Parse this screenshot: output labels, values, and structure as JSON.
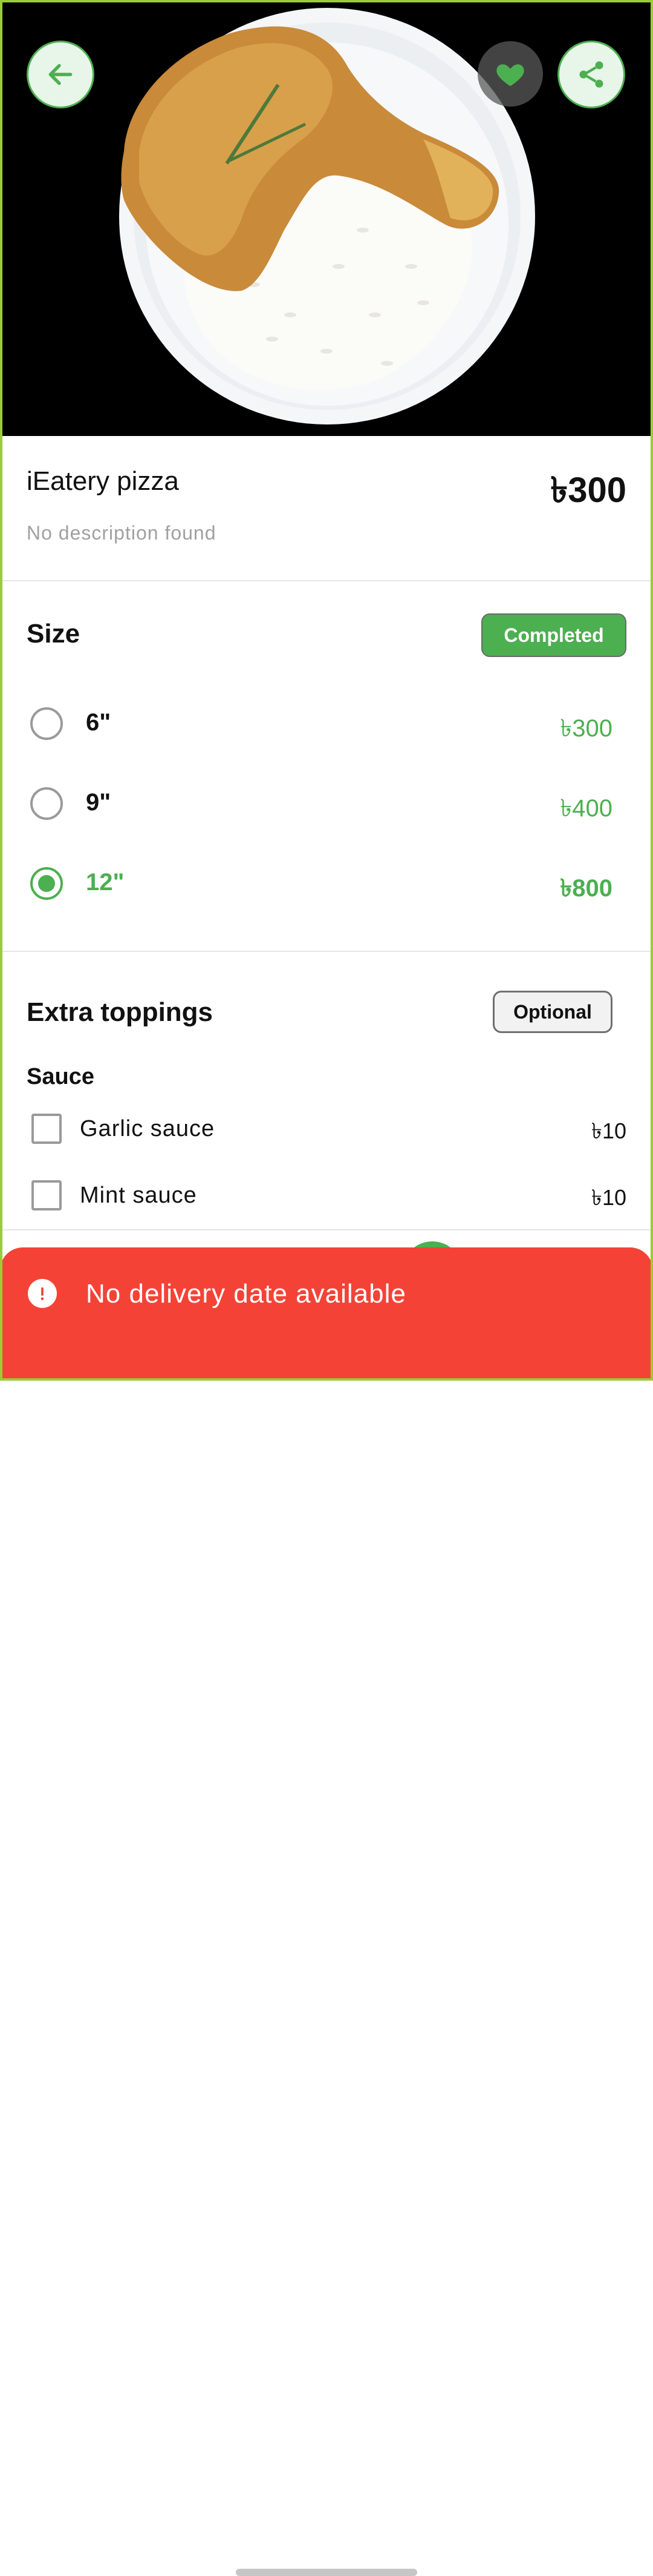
{
  "header": {
    "back_icon": "arrow-left-icon",
    "favorite_icon": "heart-icon",
    "share_icon": "share-icon"
  },
  "product": {
    "title": "iEatery pizza",
    "price": "৳300",
    "description": "No description found"
  },
  "size_section": {
    "title": "Size",
    "badge": "Completed",
    "options": [
      {
        "label": "6\"",
        "price": "৳300",
        "selected": false
      },
      {
        "label": "9\"",
        "price": "৳400",
        "selected": false
      },
      {
        "label": "12\"",
        "price": "৳800",
        "selected": true
      }
    ]
  },
  "toppings_section": {
    "title": "Extra toppings",
    "badge": "Optional",
    "group_title": "Sauce",
    "items": [
      {
        "label": "Garlic sauce",
        "price": "৳10",
        "checked": false
      },
      {
        "label": "Mint sauce",
        "price": "৳10",
        "checked": false
      }
    ]
  },
  "snackbar": {
    "message": "No delivery date available",
    "icon": "alert-circle-icon"
  },
  "colors": {
    "accent": "#4caf50",
    "snackbar": "#f44336"
  }
}
